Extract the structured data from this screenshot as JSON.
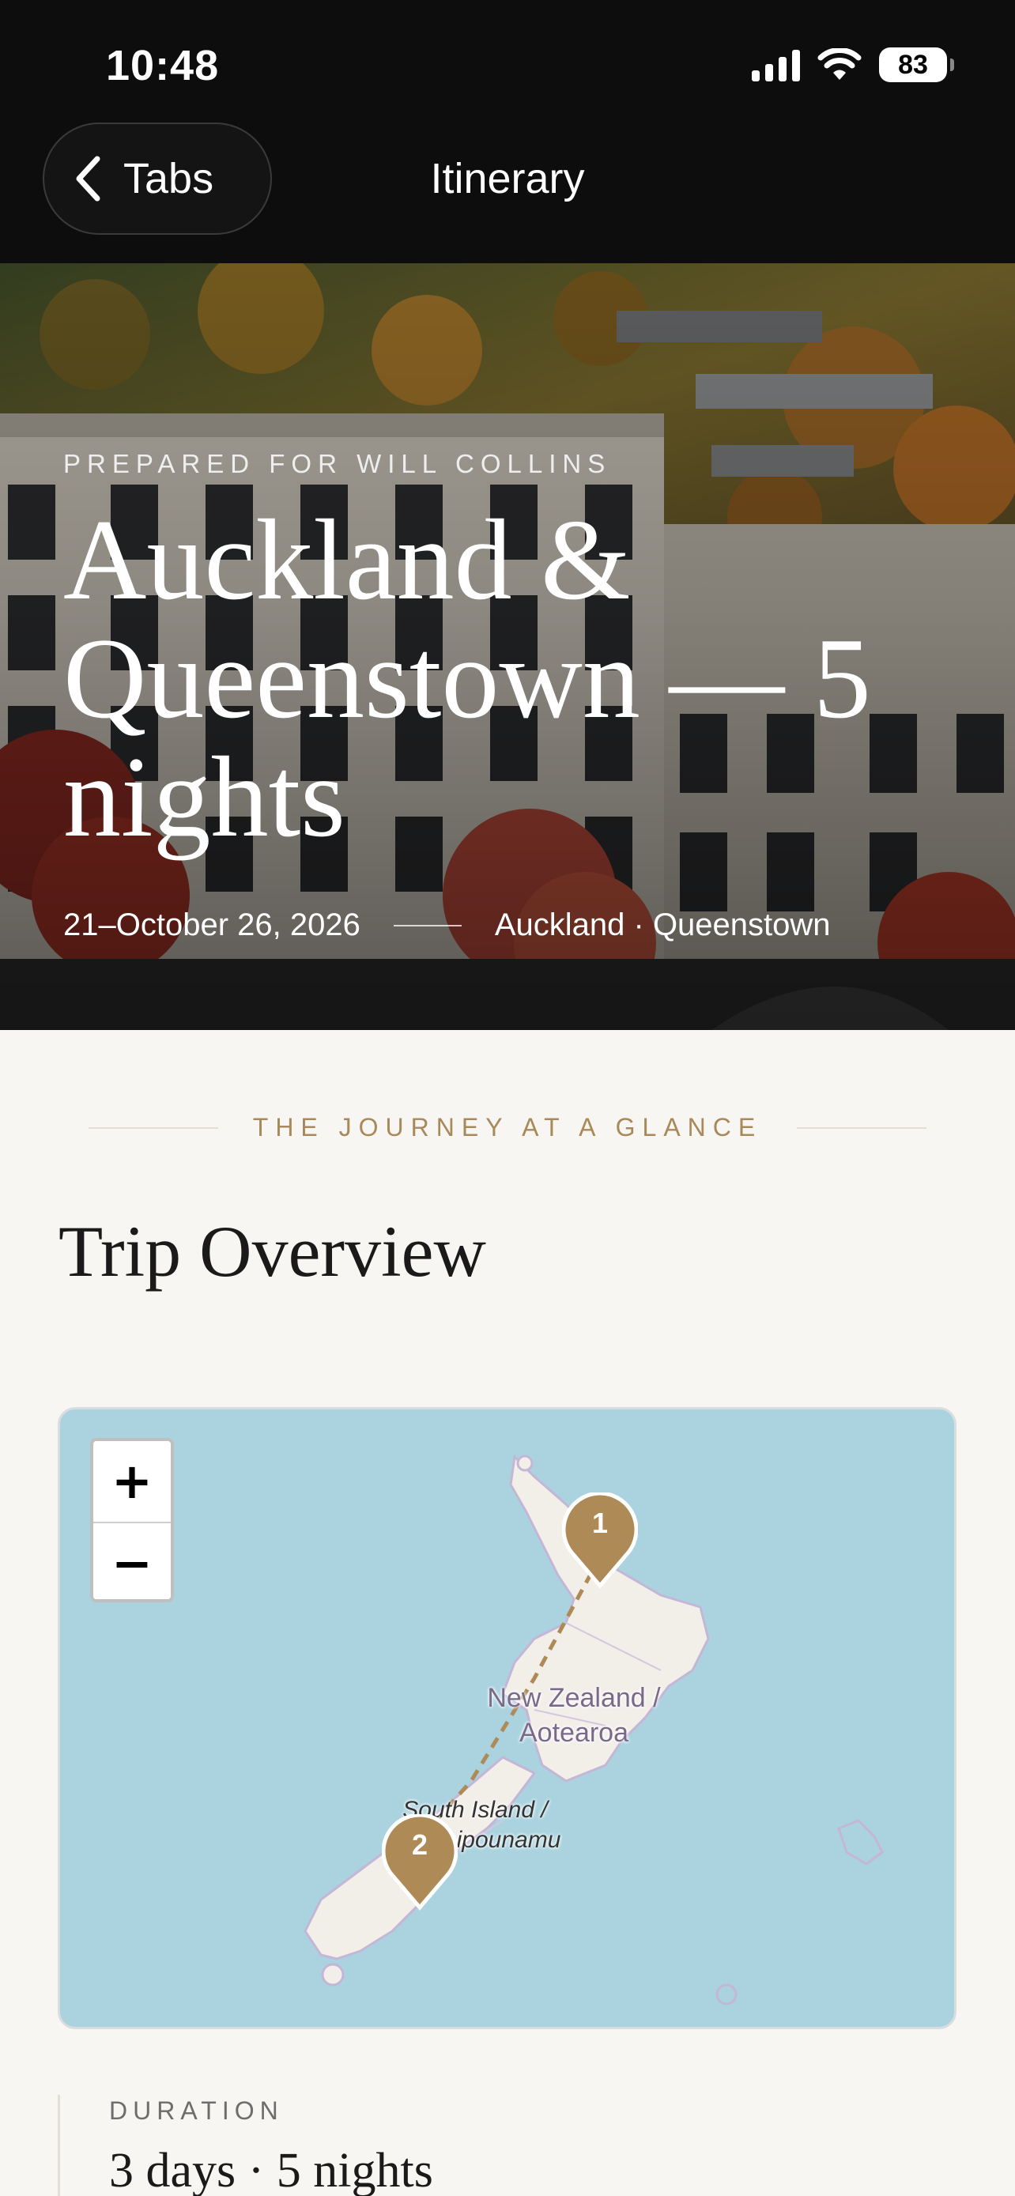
{
  "status_bar": {
    "time": "10:48",
    "battery": "83"
  },
  "nav": {
    "back_label": "Tabs",
    "title": "Itinerary"
  },
  "hero": {
    "prepared_for": "PREPARED FOR WILL COLLINS",
    "title": "Auckland & Queenstown — 5 nights",
    "dates": "21–October 26, 2026",
    "route": "Auckland · Queenstown"
  },
  "overview": {
    "eyebrow": "THE JOURNEY AT A GLANCE",
    "title": "Trip Overview"
  },
  "map": {
    "zoom_in": "+",
    "zoom_out": "−",
    "labels": {
      "country": "New Zealand / Aotearoa",
      "country_line1": "New Zealand /",
      "country_line2": "Aotearoa",
      "south_line1": "South Island /",
      "south_line2": "Te Waipounamu"
    },
    "markers": [
      {
        "number": "1",
        "place": "Auckland"
      },
      {
        "number": "2",
        "place": "Queenstown"
      }
    ],
    "colors": {
      "water": "#aad3df",
      "marker": "#ad8a56"
    }
  },
  "duration": {
    "label": "DURATION",
    "value": "3 days · 5 nights"
  }
}
